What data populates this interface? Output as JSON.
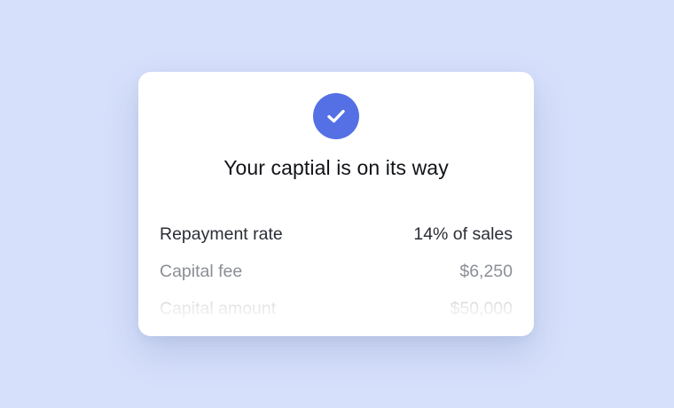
{
  "background_color": "#d6e0fb",
  "accent_color": "#5470e4",
  "card": {
    "icon": "check-icon",
    "title": "Your captial is on its way",
    "details": [
      {
        "label": "Repayment rate",
        "value": "14% of sales"
      },
      {
        "label": "Capital fee",
        "value": "$6,250"
      },
      {
        "label": "Capital amount",
        "value": "$50,000"
      }
    ]
  }
}
